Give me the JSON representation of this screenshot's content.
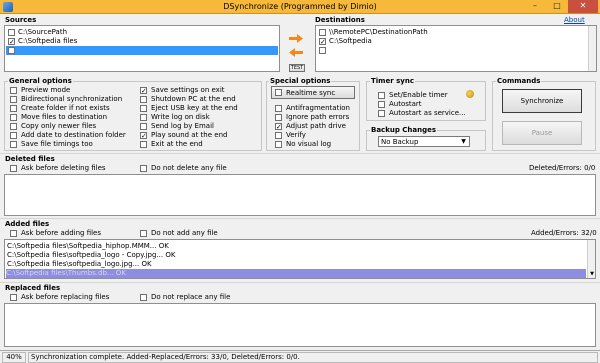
{
  "window": {
    "title": "DSynchronize (Programmed by Dimio)",
    "about": "About"
  },
  "sources": {
    "label": "Sources",
    "items": [
      {
        "text": "C:\\SourcePath",
        "checked": false
      },
      {
        "text": "C:\\Softpedia files",
        "checked": true
      },
      {
        "text": "",
        "checked": false,
        "selected": true
      }
    ]
  },
  "destinations": {
    "label": "Destinations",
    "items": [
      {
        "text": "\\\\RemotePC\\DestinationPath",
        "checked": false
      },
      {
        "text": "C:\\Softpedia",
        "checked": true
      },
      {
        "text": "",
        "checked": false
      }
    ]
  },
  "middle": {
    "test_label": "TEST"
  },
  "general": {
    "label": "General options",
    "left": [
      {
        "text": "Preview mode",
        "checked": false
      },
      {
        "text": "Bidirectional synchronization",
        "checked": false
      },
      {
        "text": "Create folder if not exists",
        "checked": false
      },
      {
        "text": "Move files to destination",
        "checked": false
      },
      {
        "text": "Copy only newer files",
        "checked": false
      },
      {
        "text": "Add date to destination folder",
        "checked": false
      },
      {
        "text": "Save file timings too",
        "checked": false
      }
    ],
    "right": [
      {
        "text": "Save settings on exit",
        "checked": true
      },
      {
        "text": "Shutdown PC at the end",
        "checked": false
      },
      {
        "text": "Eject USB key at the end",
        "checked": false
      },
      {
        "text": "Write log on disk",
        "checked": false
      },
      {
        "text": "Send log by Email",
        "checked": false
      },
      {
        "text": "Play sound at the end",
        "checked": true
      },
      {
        "text": "Exit at the end",
        "checked": false
      }
    ]
  },
  "special": {
    "label": "Special options",
    "realtime_label": "Realtime sync",
    "items": [
      {
        "text": "Antifragmentation",
        "checked": false
      },
      {
        "text": "Ignore path errors",
        "checked": false
      },
      {
        "text": "Adjust path drive",
        "checked": true
      },
      {
        "text": "Verify",
        "checked": false
      },
      {
        "text": "No visual log",
        "checked": false
      }
    ]
  },
  "timer": {
    "label": "Timer sync",
    "items": [
      {
        "text": "Set/Enable timer",
        "checked": false
      },
      {
        "text": "Autostart",
        "checked": false
      },
      {
        "text": "Autostart as service...",
        "checked": false
      }
    ]
  },
  "backup": {
    "label": "Backup Changes",
    "selected": "No Backup"
  },
  "commands": {
    "label": "Commands",
    "sync_label": "Synchronize",
    "pause_label": "Pause"
  },
  "deleted": {
    "label": "Deleted files",
    "ask": "Ask before deleting files",
    "no": "Do not delete any file",
    "errors": "Deleted/Errors: 0/0"
  },
  "added": {
    "label": "Added files",
    "ask": "Ask before adding files",
    "no": "Do not add any file",
    "errors": "Added/Errors: 32/0",
    "log": [
      "C:\\Softpedia files\\Softpedia_hiphop.MMM... OK",
      "C:\\Softpedia files\\softpedia_logo - Copy.jpg... OK",
      "C:\\Softpedia files\\softpedia_logo.jpg... OK",
      "C:\\Softpedia files\\Thumbs.db... OK"
    ]
  },
  "replaced": {
    "label": "Replaced files",
    "ask": "Ask before replacing files",
    "no": "Do not replace any file"
  },
  "status": {
    "left": "40%",
    "message": "Synchronization complete.   Added-Replaced/Errors: 33/0,   Deleted/Errors: 0/0."
  },
  "colors": {
    "title_bar": "#f7b93a",
    "selection": "#3399ff",
    "arrow": "#f08a1c"
  }
}
